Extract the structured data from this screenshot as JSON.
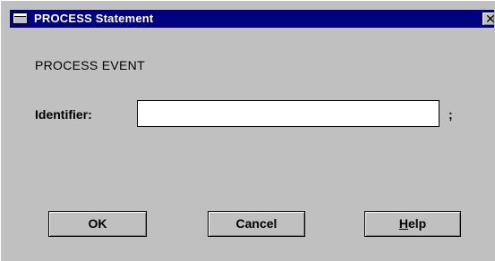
{
  "window": {
    "title": "PROCESS Statement",
    "close_glyph": "✕",
    "sysmenu_icon": "system-menu-icon",
    "close_icon": "close-icon"
  },
  "form": {
    "heading": "PROCESS EVENT",
    "identifier_label": "Identifier:",
    "identifier_value": "",
    "terminator": ";"
  },
  "buttons": {
    "ok": "OK",
    "cancel": "Cancel",
    "help_mnemonic": "H",
    "help_rest": "elp"
  },
  "colors": {
    "titlebar": "#000080",
    "face": "#c0c0c0"
  }
}
